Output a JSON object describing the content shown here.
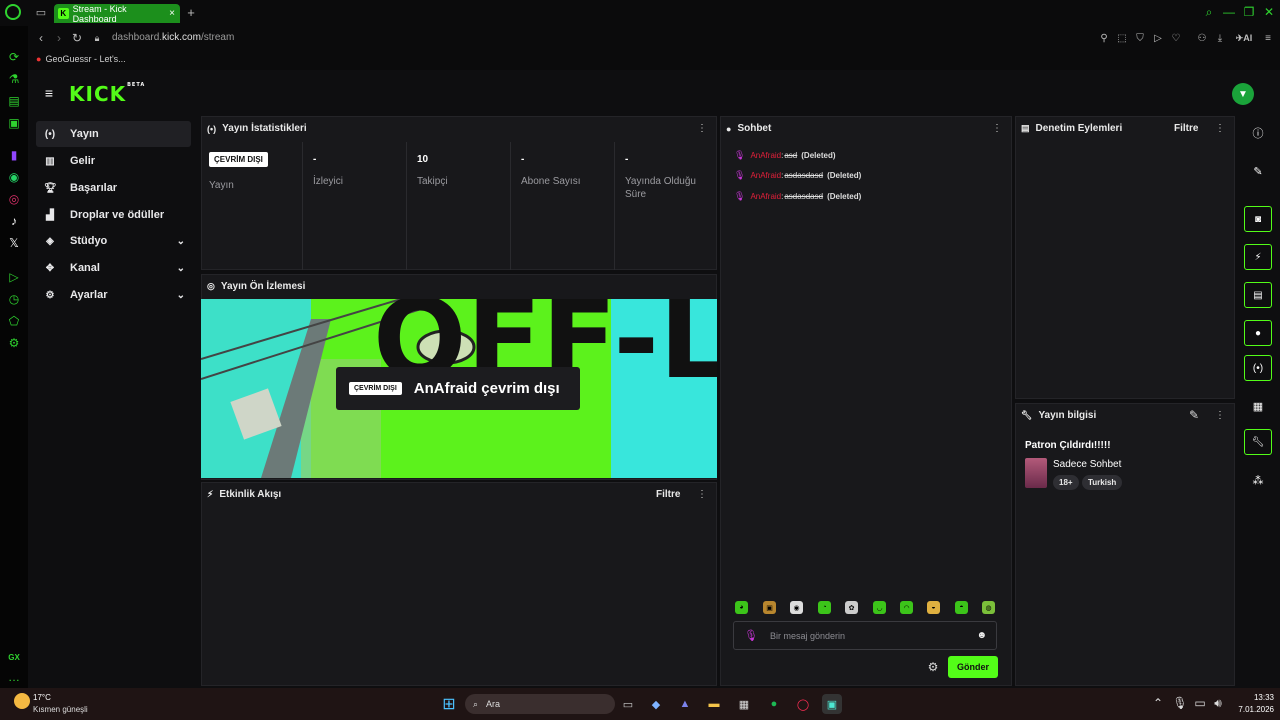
{
  "browser": {
    "tab_title": "Stream - Kick Dashboard",
    "tab_close": "×",
    "new_tab": "+",
    "url_prefix": "dashboard.",
    "url_domain": "kick.com",
    "url_path": "/stream",
    "bookmark": "GeoGuessr - Let's...",
    "ai_label": "AI"
  },
  "brand": {
    "logo": "KICK",
    "logo_sup": "BETA"
  },
  "nav": {
    "items": [
      {
        "label": "Yayın",
        "icon": "broadcast-icon"
      },
      {
        "label": "Gelir",
        "icon": "revenue-icon"
      },
      {
        "label": "Başarılar",
        "icon": "trophy-icon"
      },
      {
        "label": "Droplar ve ödüller",
        "icon": "gift-icon"
      },
      {
        "label": "Stüdyo",
        "icon": "studio-icon"
      },
      {
        "label": "Kanal",
        "icon": "channel-icon"
      },
      {
        "label": "Ayarlar",
        "icon": "settings-icon"
      }
    ]
  },
  "stats": {
    "title": "Yayın İstatistikleri",
    "status_badge": "ÇEVRİM DIŞI",
    "status_label": "Yayın",
    "viewers_value": "-",
    "viewers_label": "İzleyici",
    "followers_value": "10",
    "followers_label": "Takipçi",
    "subs_value": "-",
    "subs_label": "Abone Sayısı",
    "duration_value": "-",
    "duration_label": "Yayında Olduğu Süre"
  },
  "preview": {
    "title": "Yayın Ön İzlemesi",
    "badge": "ÇEVRİM DIŞI",
    "overlay_text": "AnAfraid çevrim dışı",
    "bg_text": "OFF-LINE"
  },
  "activity": {
    "title": "Etkinlik Akışı",
    "filter": "Filtre"
  },
  "chat": {
    "title": "Sohbet",
    "messages": [
      {
        "user": "AnAfraid",
        "sep": ":",
        "text": "asd",
        "status": "(Deleted)"
      },
      {
        "user": "AnAfraid",
        "sep": ":",
        "text": "asdasdasd",
        "status": "(Deleted)"
      },
      {
        "user": "AnAfraid",
        "sep": ":",
        "text": "asdasdasd",
        "status": "(Deleted)"
      }
    ],
    "placeholder": "Bir mesaj gönderin",
    "send": "Gönder"
  },
  "moderation": {
    "title": "Denetim Eylemleri",
    "filter": "Filtre"
  },
  "stream_info": {
    "title": "Yayın bilgisi",
    "stream_title": "Patron Çıldırdı!!!!!",
    "category": "Sadece Sohbet",
    "tags": [
      "18+",
      "Turkish"
    ]
  },
  "taskbar": {
    "temp": "17°C",
    "weather": "Kısmen güneşli",
    "search": "Ara",
    "time": "13:33",
    "date": "7.01.2026"
  },
  "colors": {
    "accent": "#53fc18",
    "panel": "#18181b",
    "bg": "#0e0e10",
    "chat_user": "#e2203a"
  }
}
